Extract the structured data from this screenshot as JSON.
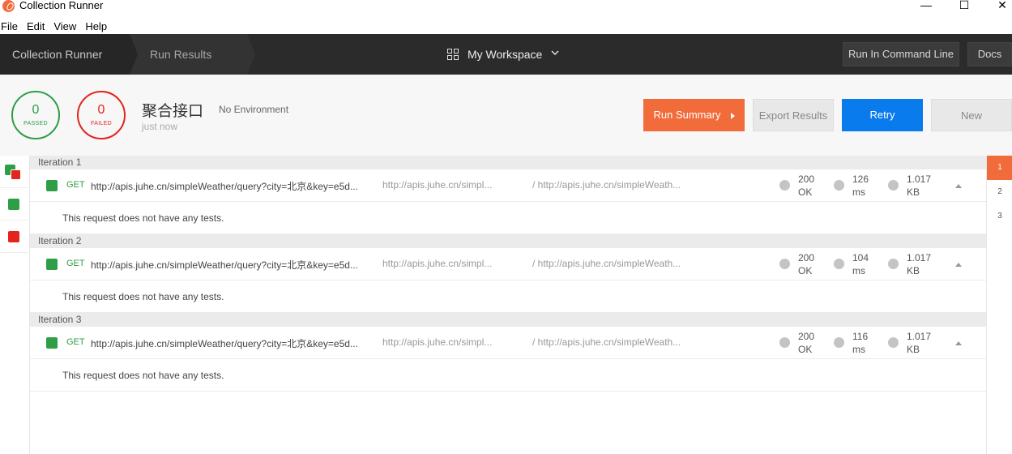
{
  "window": {
    "title": "Collection Runner",
    "minimize": "—",
    "maximize": "☐",
    "close": "✕"
  },
  "menu": [
    "File",
    "Edit",
    "View",
    "Help"
  ],
  "header": {
    "crumbs": [
      "Collection Runner",
      "Run Results"
    ],
    "workspace": "My Workspace",
    "run_cli": "Run In Command Line",
    "docs": "Docs"
  },
  "summary": {
    "passed_count": "0",
    "passed_label": "PASSED",
    "failed_count": "0",
    "failed_label": "FAILED",
    "collection": "聚合接口",
    "environment": "No Environment",
    "time": "just now",
    "run_summary": "Run Summary",
    "export": "Export Results",
    "retry": "Retry",
    "new": "New"
  },
  "colors": {
    "orange": "#f26b3a",
    "blue": "#097bed",
    "green": "#2e9e47",
    "red": "#e3251c"
  },
  "iterations": [
    {
      "title": "Iteration 1",
      "method": "GET",
      "url": "http://apis.juhe.cn/simpleWeather/query?city=北京&key=e5d...",
      "url2": "http://apis.juhe.cn/simpl...",
      "url3": "/ http://apis.juhe.cn/simpleWeath...",
      "status_code": "200",
      "status_text": "OK",
      "time": "126",
      "time_unit": "ms",
      "size": "1.017",
      "size_unit": "KB",
      "tests": "This request does not have any tests."
    },
    {
      "title": "Iteration 2",
      "method": "GET",
      "url": "http://apis.juhe.cn/simpleWeather/query?city=北京&key=e5d...",
      "url2": "http://apis.juhe.cn/simpl...",
      "url3": "/ http://apis.juhe.cn/simpleWeath...",
      "status_code": "200",
      "status_text": "OK",
      "time": "104",
      "time_unit": "ms",
      "size": "1.017",
      "size_unit": "KB",
      "tests": "This request does not have any tests."
    },
    {
      "title": "Iteration 3",
      "method": "GET",
      "url": "http://apis.juhe.cn/simpleWeather/query?city=北京&key=e5d...",
      "url2": "http://apis.juhe.cn/simpl...",
      "url3": "/ http://apis.juhe.cn/simpleWeath...",
      "status_code": "200",
      "status_text": "OK",
      "time": "116",
      "time_unit": "ms",
      "size": "1.017",
      "size_unit": "KB",
      "tests": "This request does not have any tests."
    }
  ],
  "iteration_nav": [
    "1",
    "2",
    "3"
  ]
}
